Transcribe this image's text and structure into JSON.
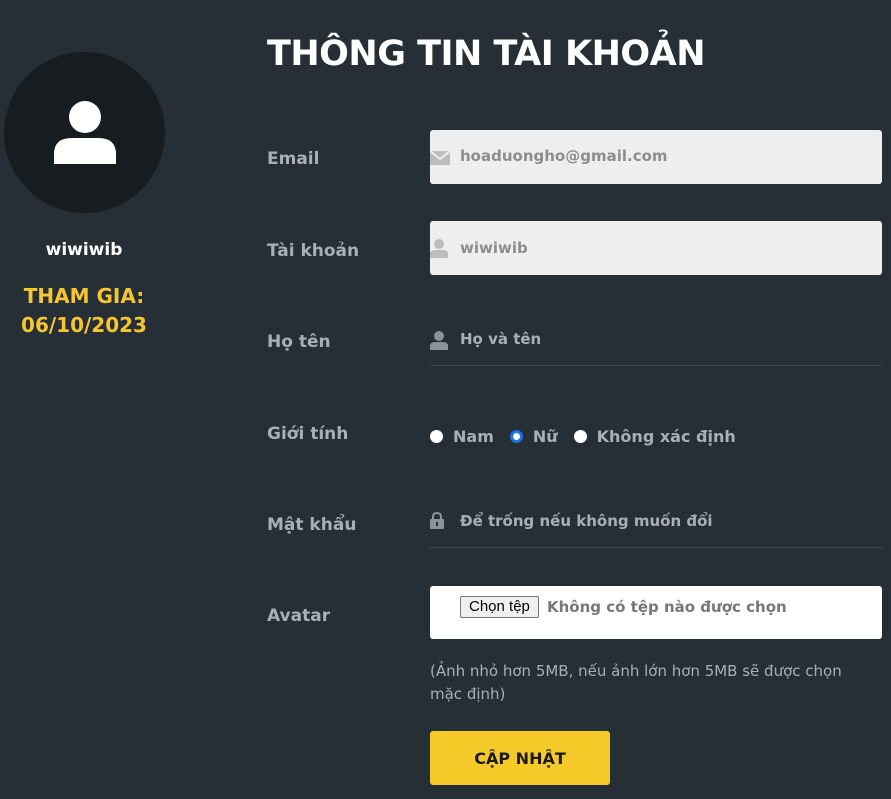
{
  "profile": {
    "username": "wiwiwib",
    "joined_label": "THAM GIA:",
    "joined_date": "06/10/2023"
  },
  "page_title": "THÔNG TIN TÀI KHOẢN",
  "form": {
    "email": {
      "label": "Email",
      "value": "hoaduongho@gmail.com",
      "icon": "envelope-icon"
    },
    "account": {
      "label": "Tài khoản",
      "value": "wiwiwib",
      "icon": "user-icon"
    },
    "fullname": {
      "label": "Họ tên",
      "placeholder": "Họ và tên",
      "icon": "user-icon"
    },
    "gender": {
      "label": "Giới tính",
      "options": [
        "Nam",
        "Nữ",
        "Không xác định"
      ],
      "selected": "Nữ"
    },
    "password": {
      "label": "Mật khẩu",
      "placeholder": "Để trống nếu không muốn đổi",
      "icon": "lock-icon"
    },
    "avatar": {
      "label": "Avatar",
      "button_label": "Chọn tệp",
      "status": "Không có tệp nào được chọn",
      "hint": "(Ảnh nhỏ hơn 5MB, nếu ảnh lớn hơn 5MB sẽ được chọn mặc định)"
    },
    "submit_label": "CẬP NHẬT"
  },
  "colors": {
    "background": "#262f36",
    "accent": "#f5c927",
    "radio_checked": "#1a73e8"
  }
}
